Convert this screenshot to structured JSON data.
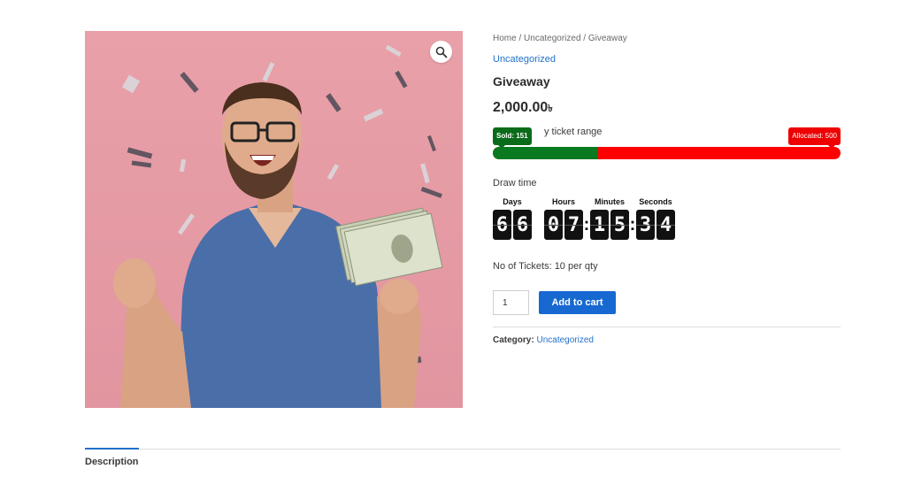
{
  "breadcrumb": {
    "home": "Home",
    "sep": " / ",
    "category": "Uncategorized",
    "current": "Giveaway"
  },
  "product": {
    "category_link": "Uncategorized",
    "title": "Giveaway",
    "price": "2,000.00",
    "currency_symbol": "৳"
  },
  "ticket_range": {
    "label": "y ticket range",
    "sold_label": "Sold: 151",
    "allocated_label": "Allocated: 500",
    "sold": 151,
    "allocated": 500,
    "sold_color": "#0a7a20",
    "remaining_color": "#ff0000"
  },
  "draw": {
    "label": "Draw time",
    "units": {
      "days": "Days",
      "hours": "Hours",
      "minutes": "Minutes",
      "seconds": "Seconds"
    },
    "days": [
      "6",
      "6"
    ],
    "hours": [
      "0",
      "7"
    ],
    "minutes": [
      "1",
      "5"
    ],
    "seconds": [
      "3",
      "4"
    ],
    "separator": ":"
  },
  "tickets_info": "No of Tickets: 10 per qty",
  "cart": {
    "quantity": "1",
    "add_label": "Add to cart"
  },
  "meta": {
    "category_prefix": "Category:",
    "category_value": "Uncategorized"
  },
  "tabs": {
    "description": "Description"
  },
  "icons": {
    "zoom": "magnifier-icon"
  },
  "colors": {
    "link": "#2271c9",
    "button": "#1769d1",
    "image_bg": "#e9a0a8"
  }
}
